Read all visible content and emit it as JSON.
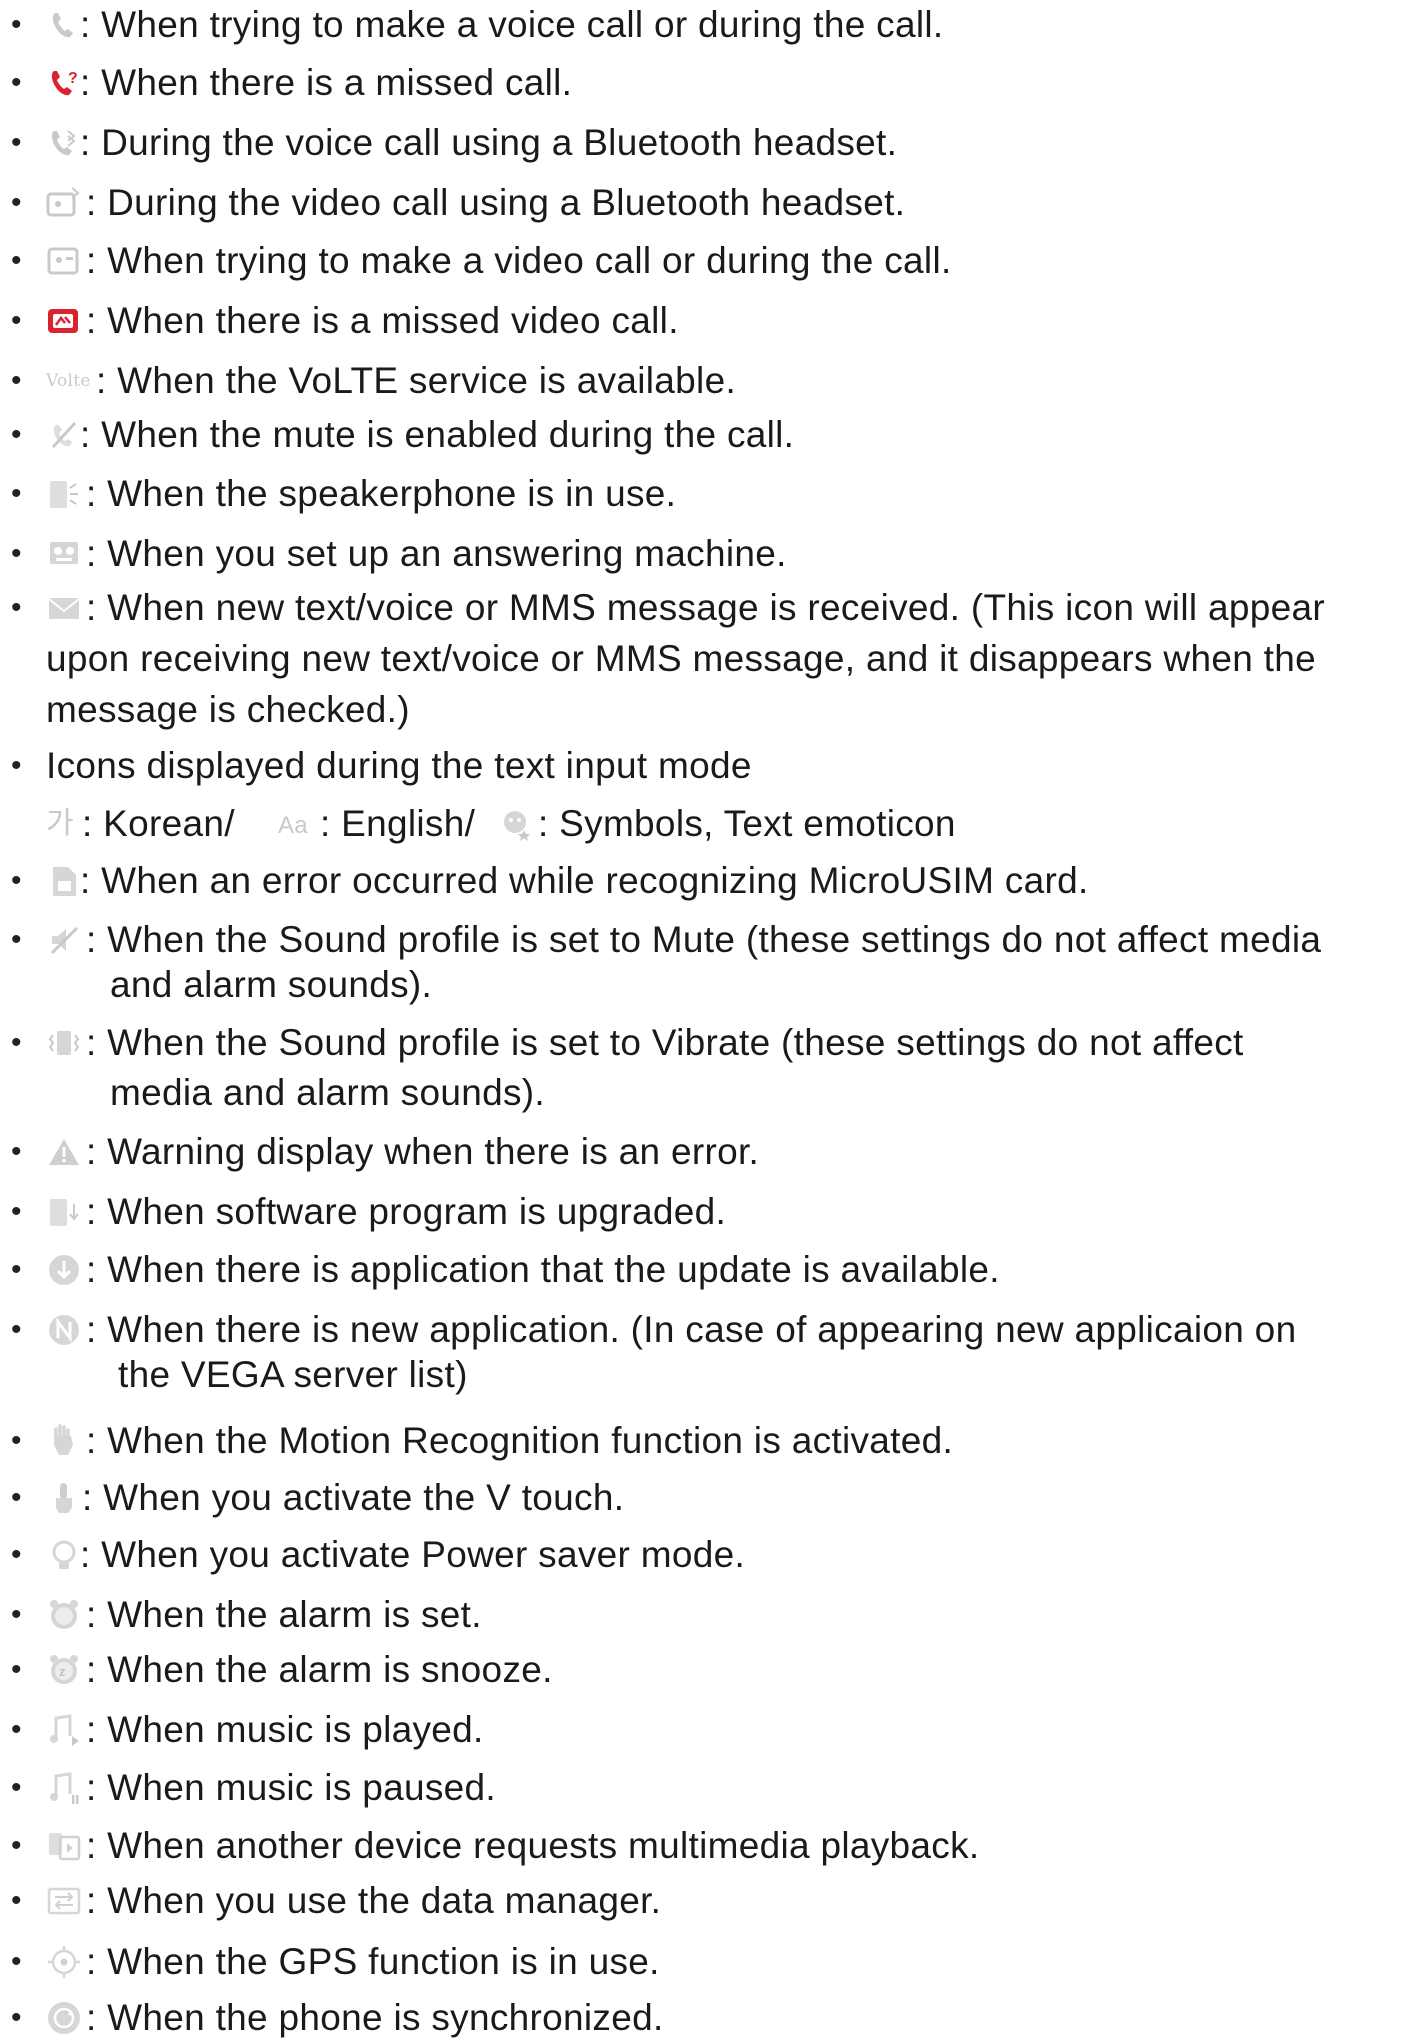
{
  "items": [
    {
      "icon": "phone-call-icon",
      "text": ": When trying to make a voice call or during the call."
    },
    {
      "icon": "missed-call-icon",
      "text": ": When there is a missed call."
    },
    {
      "icon": "bluetooth-voice-call-icon",
      "text": ": During the voice call using a Bluetooth headset."
    },
    {
      "icon": "bluetooth-video-call-icon",
      "text": ": During the video call using a Bluetooth headset."
    },
    {
      "icon": "video-call-icon",
      "text": ": When trying to make a video call or during the call."
    },
    {
      "icon": "missed-video-call-icon",
      "text": ": When there is a missed video call."
    },
    {
      "icon": "volte-icon",
      "icon_text": "Volte",
      "text": ": When the VoLTE service is available."
    },
    {
      "icon": "mute-call-icon",
      "text": ": When the mute is enabled during the call."
    },
    {
      "icon": "speakerphone-icon",
      "text": ": When the speakerphone is in use."
    },
    {
      "icon": "answering-machine-icon",
      "text": ": When you set up an answering machine."
    },
    {
      "icon": "message-icon",
      "text": ": When new text/voice or MMS message is received. (This icon will appear",
      "text2": "upon receiving new text/voice or MMS message, and it disappears when the",
      "text3": "message is checked.)"
    },
    {
      "icon": "none",
      "text": "Icons displayed during the text input mode"
    },
    {
      "icon": "input-mode-icons",
      "korean_glyph": "가",
      "korean_label": ": Korean/",
      "english_glyph": "Aa",
      "english_label": ": English/",
      "symbols_label": ": Symbols, Text emoticon"
    },
    {
      "icon": "usim-error-icon",
      "text": ": When an error occurred while recognizing MicroUSIM card."
    },
    {
      "icon": "sound-mute-icon",
      "text": ": When the Sound profile is set to Mute (these settings do not affect media",
      "text2": "and alarm sounds)."
    },
    {
      "icon": "vibrate-icon",
      "text": ": When the Sound profile is set to Vibrate (these settings do not affect",
      "text2": "media and alarm sounds)."
    },
    {
      "icon": "warning-icon",
      "text": ": Warning display when there is an error."
    },
    {
      "icon": "software-upgrade-icon",
      "text": ": When software program is upgraded."
    },
    {
      "icon": "app-update-icon",
      "text": ": When there is application that the update is available."
    },
    {
      "icon": "new-app-icon",
      "text": ": When there is new application. (In case of appearing new applicaion on",
      "text2": "the VEGA server list)"
    },
    {
      "icon": "motion-recognition-icon",
      "text": ": When the Motion Recognition function is activated."
    },
    {
      "icon": "v-touch-icon",
      "text": ": When you activate the V touch."
    },
    {
      "icon": "power-saver-icon",
      "text": ": When you activate Power saver mode."
    },
    {
      "icon": "alarm-icon",
      "text": ": When the alarm is set."
    },
    {
      "icon": "alarm-snooze-icon",
      "text": ": When the alarm is snooze."
    },
    {
      "icon": "music-play-icon",
      "text": ": When music is played."
    },
    {
      "icon": "music-pause-icon",
      "text": ": When music is paused."
    },
    {
      "icon": "multimedia-playback-icon",
      "text": ": When another device requests multimedia playback."
    },
    {
      "icon": "data-manager-icon",
      "text": ": When you use the data manager."
    },
    {
      "icon": "gps-icon",
      "text": ": When the GPS function is in use."
    },
    {
      "icon": "sync-icon",
      "text": ": When the phone is synchronized."
    }
  ],
  "colors": {
    "text": "#1a1a1a",
    "icon_gray": "#c9c9c9",
    "icon_red": "#d9232e"
  }
}
